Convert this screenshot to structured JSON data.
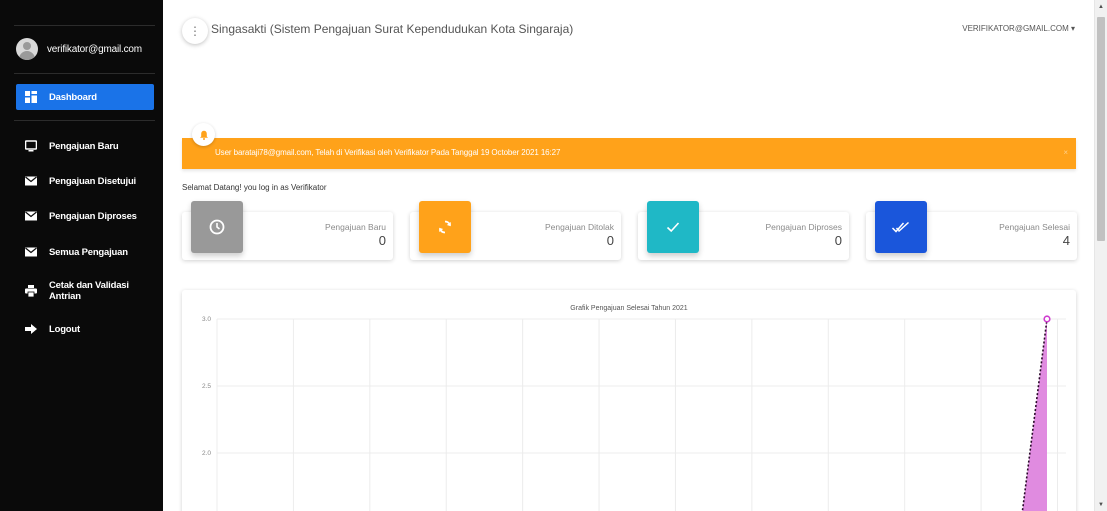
{
  "sidebar": {
    "user_email": "verifikator@gmail.com",
    "items": [
      {
        "label": "Dashboard",
        "icon": "dashboard-icon"
      },
      {
        "label": "Pengajuan Baru",
        "icon": "monitor-icon"
      },
      {
        "label": "Pengajuan Disetujui",
        "icon": "mail-icon"
      },
      {
        "label": "Pengajuan Diproses",
        "icon": "mail-icon"
      },
      {
        "label": "Semua Pengajuan",
        "icon": "mail-icon"
      },
      {
        "label": "Cetak dan Validasi Antrian",
        "icon": "printer-icon"
      },
      {
        "label": "Logout",
        "icon": "arrow-right-icon"
      }
    ]
  },
  "header": {
    "title": "Singasakti (Sistem Pengajuan Surat Kependudukan Kota Singaraja)",
    "user_menu": "VERIFIKATOR@GMAIL.COM"
  },
  "alert": {
    "text": "User barataji78@gmail.com, Telah di Verifikasi oleh Verifikator Pada Tanggal 19 October 2021 16:27",
    "close": "×",
    "color": "#ffa21a"
  },
  "welcome": "Selamat Datang! you log in as Verifikator",
  "cards": [
    {
      "label": "Pengajuan Baru",
      "value": "0",
      "icon": "clock-icon",
      "color": "#999999"
    },
    {
      "label": "Pengajuan Ditolak",
      "value": "0",
      "icon": "refresh-icon",
      "color": "#ffa21a"
    },
    {
      "label": "Pengajuan Diproses",
      "value": "0",
      "icon": "check-icon",
      "color": "#1fb8c6"
    },
    {
      "label": "Pengajuan Selesai",
      "value": "4",
      "icon": "double-check-icon",
      "color": "#1a56db"
    }
  ],
  "chart_data": {
    "type": "area",
    "title": "Grafik Pengajuan Selesai Tahun 2021",
    "y_ticks": [
      "3.0",
      "2.5",
      "2.0"
    ],
    "ylim_visible": [
      1.6,
      3.0
    ],
    "x_categories_count": 12,
    "series": [
      {
        "values": [
          0,
          0,
          0,
          0,
          0,
          0,
          0,
          0,
          0,
          0,
          0,
          3
        ],
        "color": "#cf3ccf"
      }
    ]
  }
}
